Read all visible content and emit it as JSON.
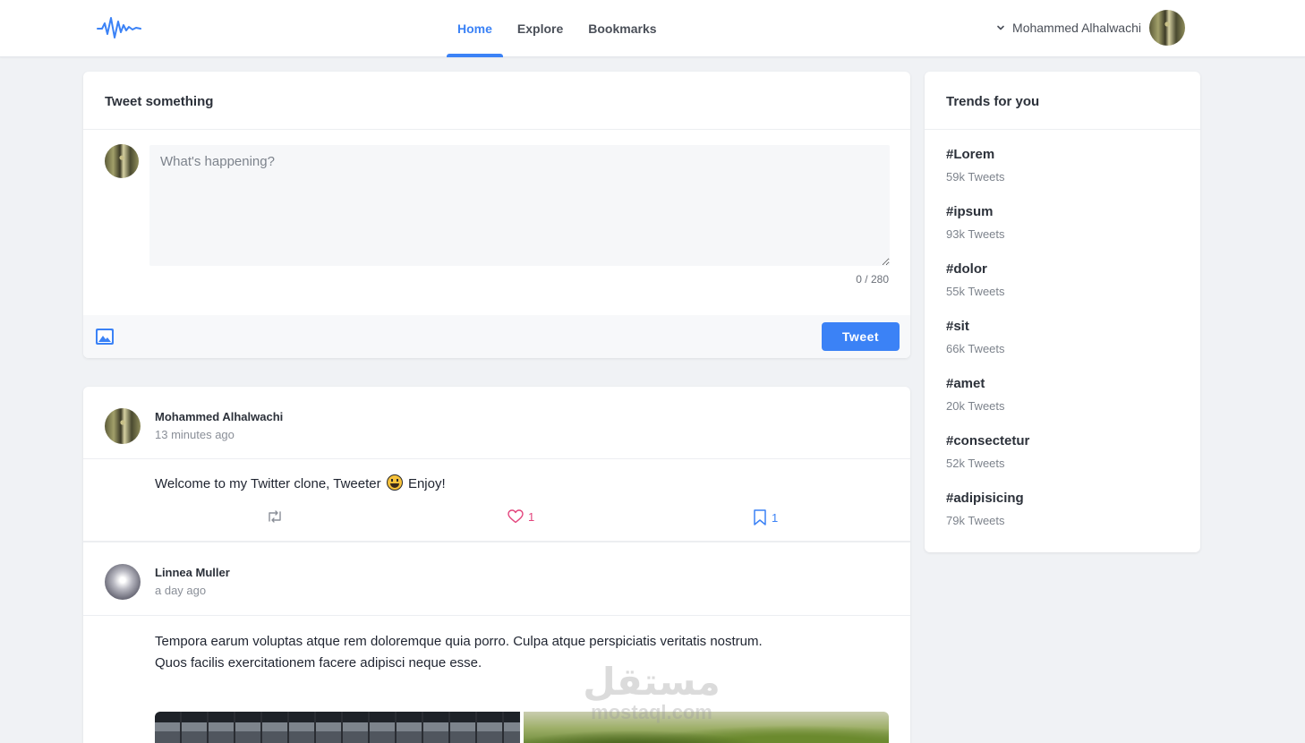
{
  "header": {
    "logo_icon": "sound-wave-logo",
    "tabs": [
      {
        "label": "Home",
        "active": true
      },
      {
        "label": "Explore",
        "active": false
      },
      {
        "label": "Bookmarks",
        "active": false
      }
    ],
    "user_name": "Mohammed Alhalwachi"
  },
  "compose": {
    "title": "Tweet something",
    "placeholder": "What's happening?",
    "value": "",
    "counter": "0 / 280",
    "image_icon": "image-icon",
    "tweet_button": "Tweet"
  },
  "posts": [
    {
      "author": "Mohammed Alhalwachi",
      "time": "13 minutes ago",
      "text_before": "Welcome to my Twitter clone, Tweeter",
      "emoji": "grinning-face",
      "text_after": "Enjoy!",
      "likes": "1",
      "bookmarks": "1"
    },
    {
      "author": "Linnea Muller",
      "time": "a day ago",
      "text": "Tempora earum voluptas atque rem doloremque quia porro. Culpa atque perspiciatis veritatis nostrum. Quos facilis exercitationem facere adipisci neque esse."
    }
  ],
  "trends": {
    "title": "Trends for you",
    "items": [
      {
        "tag": "#Lorem",
        "count": "59k Tweets"
      },
      {
        "tag": "#ipsum",
        "count": "93k Tweets"
      },
      {
        "tag": "#dolor",
        "count": "55k Tweets"
      },
      {
        "tag": "#sit",
        "count": "66k Tweets"
      },
      {
        "tag": "#amet",
        "count": "20k Tweets"
      },
      {
        "tag": "#consectetur",
        "count": "52k Tweets"
      },
      {
        "tag": "#adipisicing",
        "count": "79k Tweets"
      }
    ]
  },
  "watermark": {
    "arabic": "مستقل",
    "latin": "mostaql.com"
  },
  "colors": {
    "accent": "#3b82f6",
    "like": "#e3457d",
    "background": "#f0f2f5"
  }
}
